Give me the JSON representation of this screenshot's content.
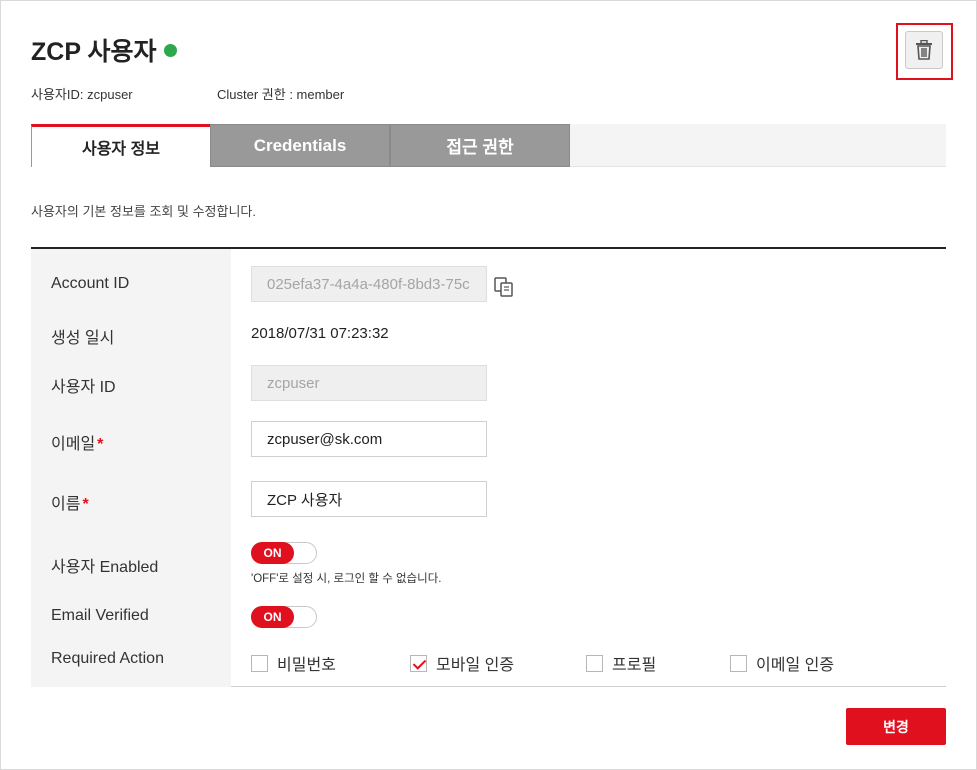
{
  "header": {
    "title": "ZCP 사용자",
    "status_color": "#2ea84a",
    "user_id_text": "사용자ID: zcpuser",
    "cluster_role_text": "Cluster 권한 : member",
    "delete_icon": "trash-icon"
  },
  "tabs": [
    {
      "label": "사용자 정보",
      "active": true
    },
    {
      "label": "Credentials",
      "active": false
    },
    {
      "label": "접근 권한",
      "active": false
    }
  ],
  "description": "사용자의 기본 정보를 조회 및 수정합니다.",
  "form": {
    "account_id": {
      "label": "Account ID",
      "value": "025efa37-4a4a-480f-8bd3-75c",
      "copy_icon": "copy-icon"
    },
    "created_at": {
      "label": "생성 일시",
      "value": "2018/07/31 07:23:32"
    },
    "username": {
      "label": "사용자 ID",
      "value": "zcpuser"
    },
    "email": {
      "label": "이메일",
      "value": "zcpuser@sk.com",
      "required_mark": "*"
    },
    "name": {
      "label": "이름",
      "value": "ZCP 사용자",
      "required_mark": "*"
    },
    "enabled": {
      "label": "사용자 Enabled",
      "toggle": "ON",
      "hint": "'OFF'로 설정 시, 로그인 할 수 없습니다."
    },
    "email_verified": {
      "label": "Email Verified",
      "toggle": "ON"
    },
    "required_action": {
      "label": "Required Action",
      "options": [
        {
          "label": "비밀번호",
          "checked": false
        },
        {
          "label": "모바일 인증",
          "checked": true
        },
        {
          "label": "프로필",
          "checked": false
        },
        {
          "label": "이메일 인증",
          "checked": false
        }
      ]
    }
  },
  "actions": {
    "save_label": "변경"
  },
  "colors": {
    "accent": "#e0101e",
    "tab_inactive": "#999999",
    "label_column": "#f4f4f4"
  }
}
